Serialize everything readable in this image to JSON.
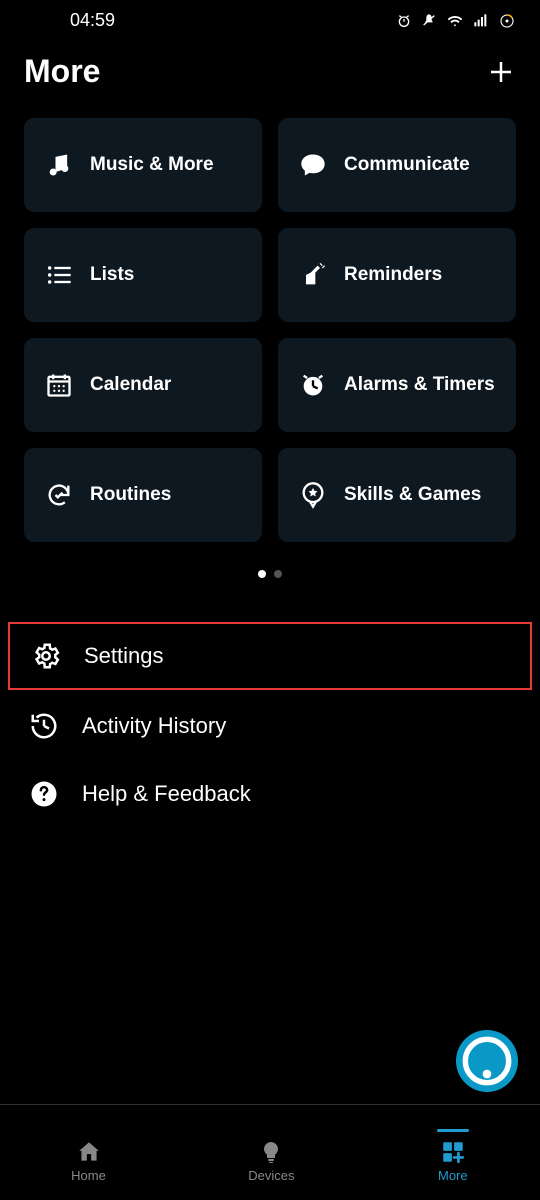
{
  "status": {
    "time": "04:59"
  },
  "header": {
    "title": "More"
  },
  "cards": [
    {
      "label": "Music & More",
      "icon": "music"
    },
    {
      "label": "Communicate",
      "icon": "chat"
    },
    {
      "label": "Lists",
      "icon": "lists"
    },
    {
      "label": "Reminders",
      "icon": "reminder"
    },
    {
      "label": "Calendar",
      "icon": "calendar"
    },
    {
      "label": "Alarms & Timers",
      "icon": "alarm"
    },
    {
      "label": "Routines",
      "icon": "routines"
    },
    {
      "label": "Skills & Games",
      "icon": "skills"
    }
  ],
  "pager": {
    "active": 0,
    "count": 2
  },
  "list": [
    {
      "label": "Settings",
      "icon": "gear",
      "highlight": true
    },
    {
      "label": "Activity History",
      "icon": "history",
      "highlight": false
    },
    {
      "label": "Help & Feedback",
      "icon": "help",
      "highlight": false
    }
  ],
  "bottom_nav": [
    {
      "label": "Home",
      "icon": "home",
      "active": false
    },
    {
      "label": "Devices",
      "icon": "bulb",
      "active": false
    },
    {
      "label": "More",
      "icon": "more",
      "active": true
    }
  ]
}
